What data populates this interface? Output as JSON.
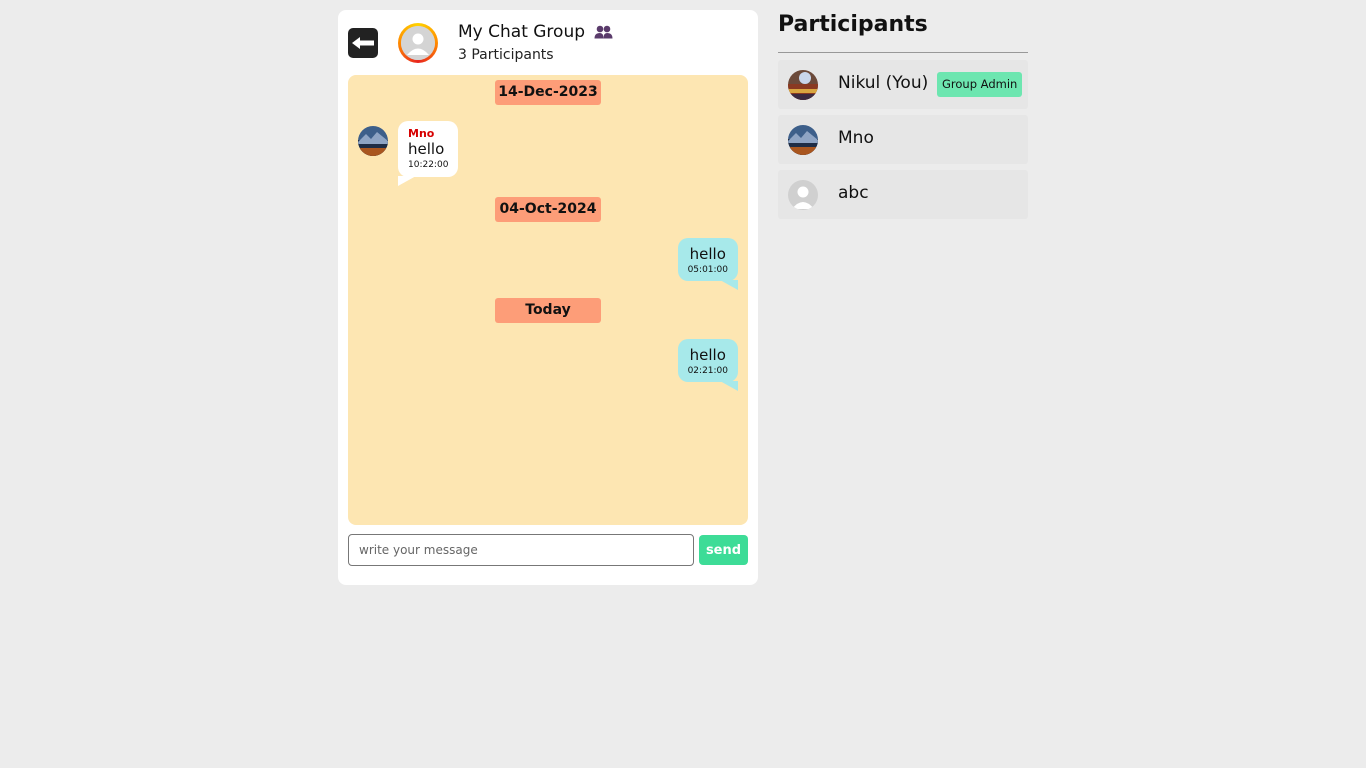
{
  "chat": {
    "group_name": "My Chat Group",
    "participants_count_label": "3 Participants",
    "back_icon": "arrow-left-icon",
    "group_icon": "people-icon",
    "dates": [
      "14-Dec-2023",
      "04-Oct-2024",
      "Today"
    ],
    "messages": [
      {
        "direction": "incoming",
        "sender": "Mno",
        "text": "hello",
        "time": "10:22:00"
      },
      {
        "direction": "outgoing",
        "text": "hello",
        "time": "05:01:00"
      },
      {
        "direction": "outgoing",
        "text": "hello",
        "time": "02:21:00"
      }
    ],
    "input_placeholder": "write your message",
    "send_label": "send"
  },
  "participants": {
    "title": "Participants",
    "items": [
      {
        "name": "Nikul (You)",
        "badge": "Group Admin"
      },
      {
        "name": "Mno"
      },
      {
        "name": "abc"
      }
    ]
  },
  "colors": {
    "page_bg": "#ececec",
    "chat_bg": "#fde6b2",
    "date_chip": "#fd9d78",
    "outgoing_bubble": "#a7e9ea",
    "send_button": "#3ddc97",
    "admin_badge": "#6de6b0",
    "sender_name": "#d60000"
  }
}
